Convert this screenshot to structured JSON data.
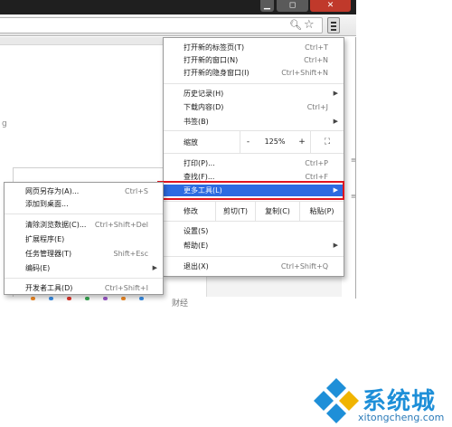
{
  "window": {
    "min_symbol": "▁",
    "max_symbol": "◻",
    "close_symbol": "✕"
  },
  "toolbar": {
    "zoom_icon": "zoom-icon",
    "star_icon": "bookmark-star-icon",
    "menu_icon": "hamburger-menu-icon"
  },
  "page": {
    "edge_text": "g",
    "caijing": "财经",
    "bullet_colors": [
      "#f08a24",
      "#3a8ee6",
      "#e2342b",
      "#38a852",
      "#9a56c9",
      "#f08a24",
      "#3a8ee6"
    ]
  },
  "main_menu": {
    "new_tab": {
      "label": "打开新的标签页(T)",
      "shortcut": "Ctrl+T"
    },
    "new_window": {
      "label": "打开新的窗口(N)",
      "shortcut": "Ctrl+N"
    },
    "new_incognito": {
      "label": "打开新的隐身窗口(I)",
      "shortcut": "Ctrl+Shift+N"
    },
    "history": {
      "label": "历史记录(H)"
    },
    "downloads": {
      "label": "下载内容(D)",
      "shortcut": "Ctrl+J"
    },
    "bookmarks": {
      "label": "书签(B)"
    },
    "zoom": {
      "label": "缩放",
      "minus": "-",
      "value": "125%",
      "plus": "+",
      "fullscreen": "⛶"
    },
    "print": {
      "label": "打印(P)...",
      "shortcut": "Ctrl+P"
    },
    "find": {
      "label": "查找(F)...",
      "shortcut": "Ctrl+F"
    },
    "more_tools": {
      "label": "更多工具(L)"
    },
    "edit": {
      "label": "修改",
      "cut": "剪切(T)",
      "copy": "复制(C)",
      "paste": "粘贴(P)"
    },
    "settings": {
      "label": "设置(S)"
    },
    "help": {
      "label": "帮助(E)"
    },
    "exit": {
      "label": "退出(X)",
      "shortcut": "Ctrl+Shift+Q"
    }
  },
  "sub_menu": {
    "save_page": {
      "label": "网页另存为(A)...",
      "shortcut": "Ctrl+S"
    },
    "add_to_desktop": {
      "label": "添加到桌面..."
    },
    "clear_data": {
      "label": "清除浏览数据(C)...",
      "shortcut": "Ctrl+Shift+Del"
    },
    "extensions": {
      "label": "扩展程序(E)"
    },
    "task_manager": {
      "label": "任务管理器(T)",
      "shortcut": "Shift+Esc"
    },
    "encoding": {
      "label": "编码(E)"
    },
    "dev_tools": {
      "label": "开发者工具(D)",
      "shortcut": "Ctrl+Shift+I"
    }
  },
  "colors": {
    "highlight": "#2d6be1",
    "highlight_box": "#e0141e",
    "watermark_blue": "#1e8fd8"
  },
  "watermark": {
    "title": "系统城",
    "url": "xitongcheng.com",
    "logo": "diamond-logo"
  }
}
